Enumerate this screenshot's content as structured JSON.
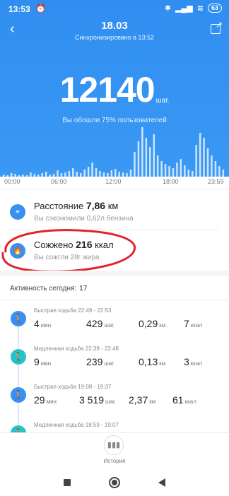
{
  "status_bar": {
    "time": "13:53",
    "battery": "63"
  },
  "header": {
    "date": "18.03",
    "sync": "Синхронизировано в 13:52"
  },
  "steps": {
    "value": "12140",
    "unit": "шаг.",
    "compare": "Вы обошли 75% пользователей"
  },
  "timeline": [
    "00:00",
    "06:00",
    "12:00",
    "18:00",
    "23:59"
  ],
  "histogram_levels": [
    0.03,
    0.02,
    0.05,
    0.04,
    0.02,
    0.03,
    0.02,
    0.06,
    0.04,
    0.03,
    0.05,
    0.07,
    0.03,
    0.04,
    0.09,
    0.05,
    0.06,
    0.08,
    0.12,
    0.07,
    0.05,
    0.1,
    0.14,
    0.2,
    0.12,
    0.08,
    0.06,
    0.05,
    0.09,
    0.11,
    0.07,
    0.06,
    0.05,
    0.1,
    0.35,
    0.5,
    0.7,
    0.55,
    0.42,
    0.6,
    0.3,
    0.22,
    0.18,
    0.15,
    0.12,
    0.2,
    0.25,
    0.16,
    0.1,
    0.08,
    0.45,
    0.62,
    0.55,
    0.4,
    0.3,
    0.22,
    0.15,
    0.1
  ],
  "stats": {
    "distance": {
      "label": "Расстояние",
      "value": "7,86",
      "unit": "км",
      "sub": "Вы сэкономили 0,62л бензина"
    },
    "calories": {
      "label": "Сожжено",
      "value": "216",
      "unit": "ккал",
      "sub": "Вы сожгли 28г жира"
    }
  },
  "activity": {
    "title": "Активность сегодня:",
    "count": "17"
  },
  "activities": [
    {
      "label": "Быстрая ходьба 22:49 - 22:53",
      "min": "4",
      "steps": "429",
      "km": "0,29",
      "kcal": "7"
    },
    {
      "label": "Медленная ходьба 22:39 - 22:48",
      "min": "9",
      "steps": "239",
      "km": "0,13",
      "kcal": "3"
    },
    {
      "label": "Быстрая ходьба 19:08 - 19:37",
      "min": "29",
      "steps": "3 519",
      "km": "2,37",
      "kcal": "61"
    },
    {
      "label": "Медленная ходьба 18:59 - 19:07"
    }
  ],
  "units": {
    "min": "мин",
    "steps": "шаг.",
    "km": "км",
    "kcal": "ккал"
  },
  "bottom": {
    "history": "История"
  },
  "colors": {
    "accent": "#3a8ff0",
    "fast_walk": "#3a8ff0",
    "slow_walk": "#26c1c9",
    "annotation": "#e0242e"
  }
}
